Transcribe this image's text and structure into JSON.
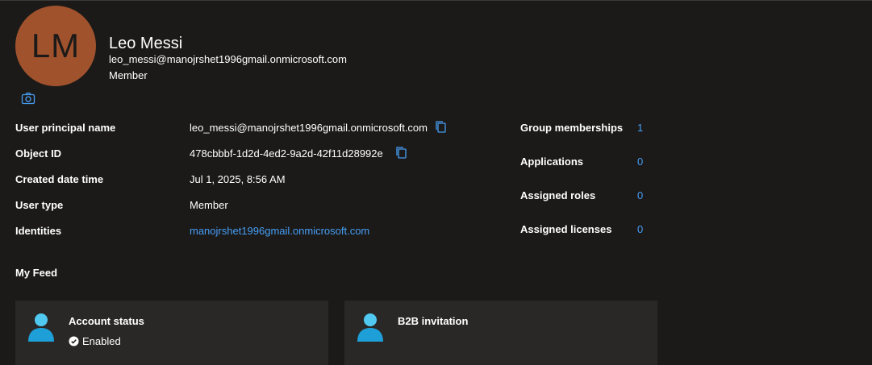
{
  "profile": {
    "initials": "LM",
    "name": "Leo Messi",
    "email": "leo_messi@manojrshet1996gmail.onmicrosoft.com",
    "role": "Member"
  },
  "properties": [
    {
      "label": "User principal name",
      "value": "leo_messi@manojrshet1996gmail.onmicrosoft.com"
    },
    {
      "label": "Object ID",
      "value": "478cbbbf-1d2d-4ed2-9a2d-42f11d28992e"
    },
    {
      "label": "Created date time",
      "value": "Jul 1, 2025, 8:56 AM"
    },
    {
      "label": "User type",
      "value": "Member"
    },
    {
      "label": "Identities",
      "value": "manojrshet1996gmail.onmicrosoft.com"
    }
  ],
  "stats": [
    {
      "label": "Group memberships",
      "value": "1"
    },
    {
      "label": "Applications",
      "value": "0"
    },
    {
      "label": "Assigned roles",
      "value": "0"
    },
    {
      "label": "Assigned licenses",
      "value": "0"
    }
  ],
  "feed": {
    "title": "My Feed",
    "cards": [
      {
        "title": "Account status",
        "status": "Enabled"
      },
      {
        "title": "B2B invitation",
        "status": ""
      }
    ]
  },
  "colors": {
    "background": "#1b1a19",
    "card": "#292827",
    "link": "#479ef5",
    "avatar": "#a0522d"
  },
  "icons": [
    "camera-icon",
    "copy-icon",
    "person-icon",
    "check-circle-icon"
  ]
}
